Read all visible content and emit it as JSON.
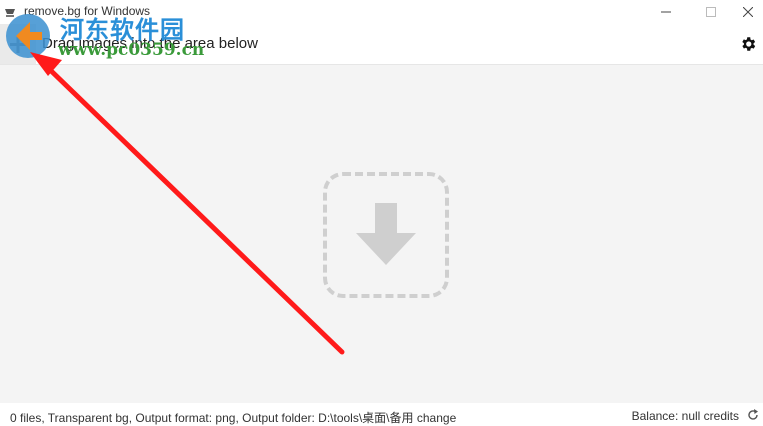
{
  "window": {
    "title": "remove.bg for Windows"
  },
  "toolbar": {
    "instruction": "Drag images into the area below"
  },
  "status": {
    "summary": "0 files, Transparent bg, Output format: png, Output folder: D:\\tools\\桌面\\备用",
    "change_link": "change",
    "balance": "Balance: null credits"
  },
  "watermark": {
    "title": "河东软件园",
    "url": "www.pc0359.cn"
  },
  "colors": {
    "dropzone_bg": "#f4f4f4",
    "drop_icon": "#cfcfcf",
    "annotation_arrow": "#ff1a1a"
  }
}
